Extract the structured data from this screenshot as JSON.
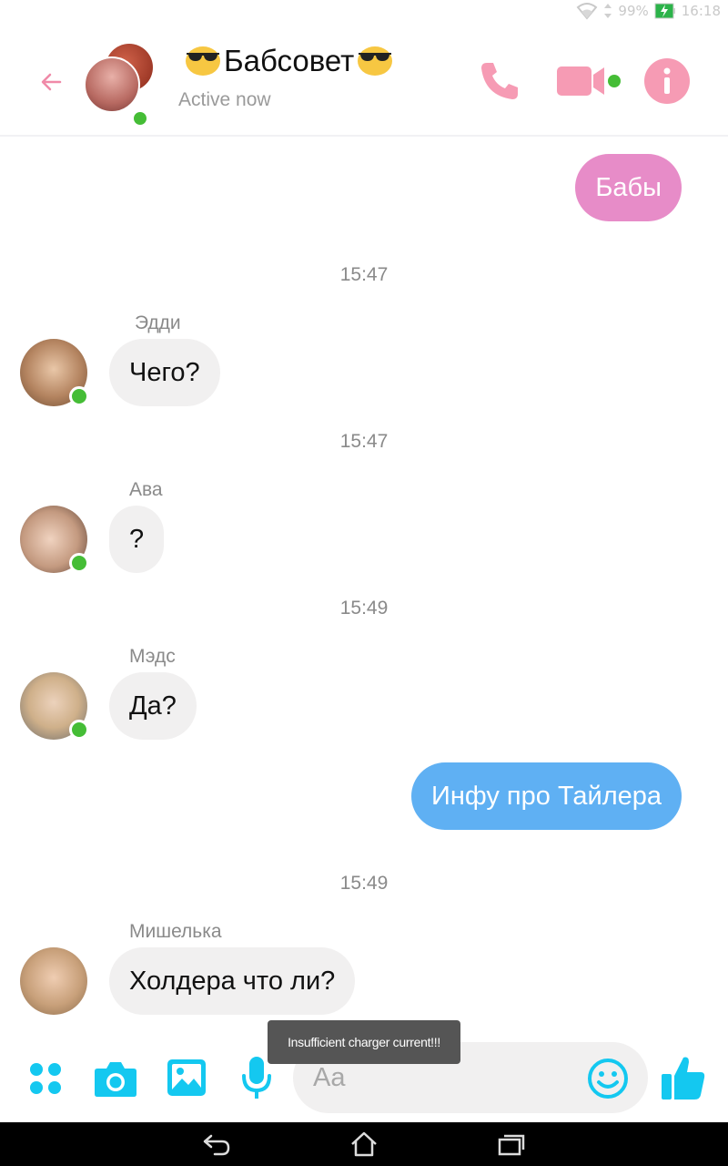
{
  "status_bar": {
    "battery_percent": "99%",
    "time": "16:18"
  },
  "header": {
    "title": "Бабсовет",
    "title_emoji": "sunglasses-emoji",
    "subtitle": "Active now",
    "icons": [
      "back-arrow-icon",
      "phone-icon",
      "video-camera-icon",
      "info-icon"
    ]
  },
  "messages": [
    {
      "type": "outgoing",
      "style": "pink",
      "text": "Бабы"
    },
    {
      "type": "timestamp",
      "text": "15:47"
    },
    {
      "type": "incoming",
      "sender": "Эдди",
      "text": "Чего?"
    },
    {
      "type": "timestamp",
      "text": "15:47"
    },
    {
      "type": "incoming",
      "sender": "Ава",
      "text": "?"
    },
    {
      "type": "timestamp",
      "text": "15:49"
    },
    {
      "type": "incoming",
      "sender": "Мэдс",
      "text": "Да?"
    },
    {
      "type": "outgoing",
      "style": "blue",
      "text": "Инфу про Тайлера"
    },
    {
      "type": "timestamp",
      "text": "15:49"
    },
    {
      "type": "incoming",
      "sender": "Мишелька",
      "text": "Холдера что ли?"
    }
  ],
  "toast": "Insufficient charger current!!!",
  "composer": {
    "placeholder": "Aa",
    "value": "",
    "icons": [
      "apps-icon",
      "camera-icon",
      "image-icon",
      "microphone-icon",
      "smiley-icon",
      "thumbs-up-icon"
    ]
  },
  "colors": {
    "accent_pink": "#f69bb4",
    "accent_cyan": "#14c8f0",
    "bubble_pink": "#e78cc8",
    "bubble_blue": "#5fb0f3",
    "online_green": "#45bd36"
  }
}
